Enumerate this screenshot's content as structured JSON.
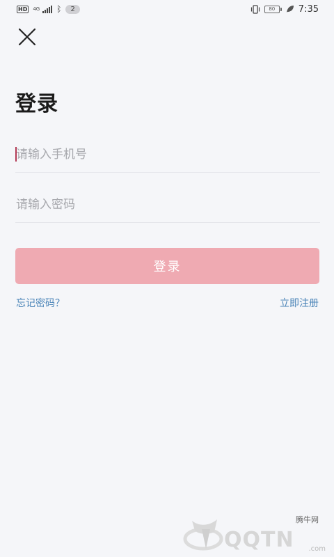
{
  "status_bar": {
    "hd": "HD",
    "network": "4G",
    "notification_count": "2",
    "battery": "80",
    "time": "7:35"
  },
  "page": {
    "title": "登录"
  },
  "form": {
    "phone_placeholder": "请输入手机号",
    "password_placeholder": "请输入密码",
    "login_button_label": "登录",
    "forgot_password_label": "忘记密码？",
    "register_label": "立即注册"
  },
  "watermark": {
    "brand_cn": "腾牛网",
    "brand_text": "QQTN",
    "site": ".com"
  },
  "colors": {
    "background": "#f5f6f9",
    "button": "#efaab2",
    "link": "#4a84b8",
    "caret": "#b33a55"
  }
}
